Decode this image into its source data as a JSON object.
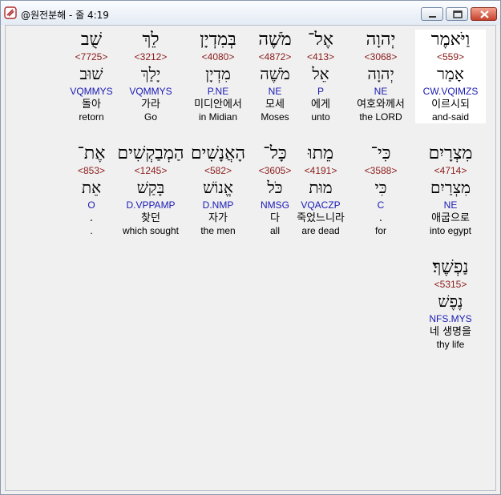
{
  "window": {
    "title": "@원전분해 - 줄 4:19"
  },
  "lines": [
    [
      {
        "heb": "וַיֹּאמֶר",
        "strong": "<559>",
        "root": "אָמַר",
        "parse": "CW.VQIMZS",
        "kor": "이르시되",
        "eng": "and-said",
        "highlight": true
      },
      {
        "heb": "יְהוָה",
        "strong": "<3068>",
        "root": "יְהוָה",
        "parse": "NE",
        "kor": "여호와께서",
        "eng": "the LORD"
      },
      {
        "heb": "אֶל־",
        "strong": "<413>",
        "root": "אֵל",
        "parse": "P",
        "kor": "에게",
        "eng": "unto"
      },
      {
        "heb": "מֹשֶׁה",
        "strong": "<4872>",
        "root": "מֹשֶׁה",
        "parse": "NE",
        "kor": "모세",
        "eng": "Moses"
      },
      {
        "heb": "בְּמִדְיָן",
        "strong": "<4080>",
        "root": "מִדְיָן",
        "parse": "P.NE",
        "kor": "미디안에서",
        "eng": "in Midian"
      },
      {
        "heb": "לֵךְ",
        "strong": "<3212>",
        "root": "יָלַךְ",
        "parse": "VQMMYS",
        "kor": "가라",
        "eng": "Go"
      },
      {
        "heb": "שֻׁב",
        "strong": "<7725>",
        "root": "שׁוּב",
        "parse": "VQMMYS",
        "kor": "돌아",
        "eng": "retorn"
      }
    ],
    [
      {
        "heb": "מִצְרָיִם",
        "strong": "<4714>",
        "root": "מִצְרַיִם",
        "parse": "NE",
        "kor": "애굽으로",
        "eng": "into egypt"
      },
      {
        "heb": "כִּי־",
        "strong": "<3588>",
        "root": "כִּי",
        "parse": "C",
        "kor": ".",
        "eng": "for"
      },
      {
        "heb": "מֵתוּ",
        "strong": "<4191>",
        "root": "מוּת",
        "parse": "VQACZP",
        "kor": "죽었느니라",
        "eng": "are dead"
      },
      {
        "heb": "כָּל־",
        "strong": "<3605>",
        "root": "כֹּל",
        "parse": "NMSG",
        "kor": "다",
        "eng": "all"
      },
      {
        "heb": "הָאֲנָשִׁים",
        "strong": "<582>",
        "root": "אֱנוֹשׁ",
        "parse": "D.NMP",
        "kor": "자가",
        "eng": "the men"
      },
      {
        "heb": "הַמְבַקְשִׁים",
        "strong": "<1245>",
        "root": "בָּקַשׁ",
        "parse": "D.VPPAMP",
        "kor": "찾던",
        "eng": "which sought"
      },
      {
        "heb": "אֶת־",
        "strong": "<853>",
        "root": "אֵת",
        "parse": "O",
        "kor": ".",
        "eng": "."
      }
    ],
    [
      {
        "heb": "נַפְשֶׁךָ׃",
        "strong": "<5315>",
        "root": "נֶפֶשׁ",
        "parse": "NFS.MYS",
        "kor": "네 생명을",
        "eng": "thy life"
      }
    ]
  ]
}
